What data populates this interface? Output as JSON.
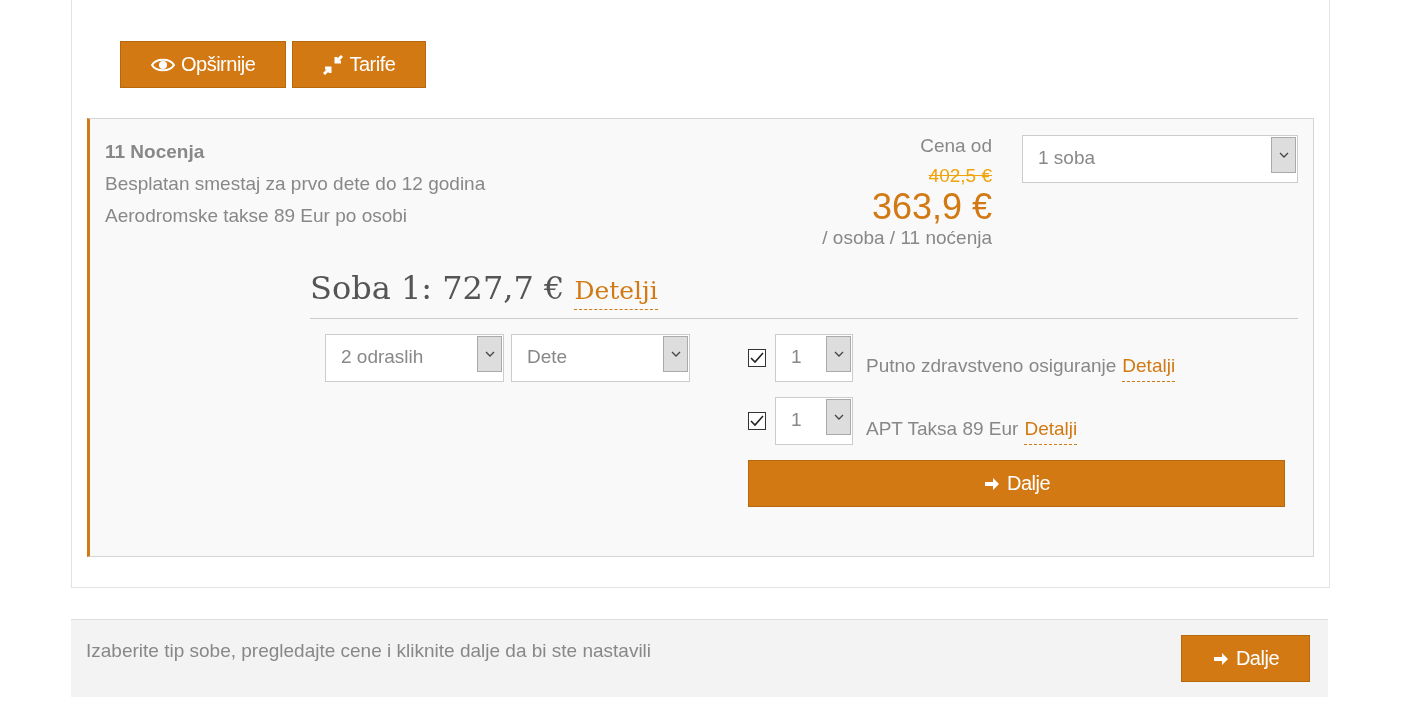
{
  "actions": [
    {
      "kind": "eye",
      "label": "Opširnije"
    },
    {
      "kind": "compress",
      "label": "Tarife"
    }
  ],
  "offer": {
    "title": "11 Nocenja",
    "notes": [
      "Besplatan smestaj za prvo dete do 12 godina",
      "Aerodromske takse 89 Eur po osobi"
    ],
    "price": {
      "label": "Cena od",
      "old": "402,5 €",
      "current": "363,9 €",
      "unit": "/ osoba / 11 noćenja"
    },
    "rooms_select": "1 soba",
    "room": {
      "title": "Soba 1: 727,7 €",
      "link": "Detelji",
      "guests": [
        "2 odraslih",
        "Dete"
      ],
      "extras": [
        {
          "checked": true,
          "quantity": "1",
          "label": "Putno zdravstveno osiguranje",
          "link": "Detalji"
        },
        {
          "checked": true,
          "quantity": "1",
          "label": "APT Taksa 89 Eur",
          "link": "Detalji"
        }
      ],
      "next": "Dalje"
    }
  },
  "footer": {
    "text": "Izaberite tip sobe, pregledajte cene i kliknite dalje da bi ste nastavili",
    "next": "Dalje"
  }
}
